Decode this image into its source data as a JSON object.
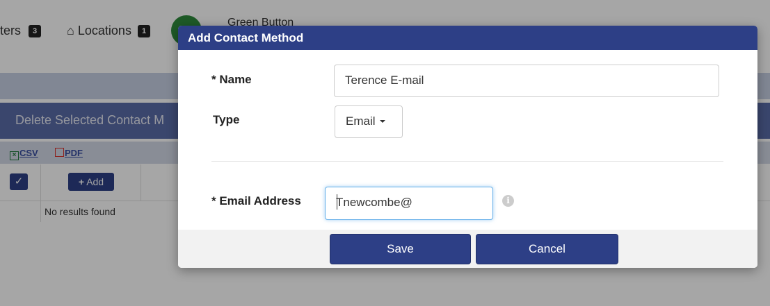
{
  "background": {
    "nav": {
      "meters_label": "ters",
      "meters_count": "3",
      "locations_label": "Locations",
      "locations_count": "1",
      "green_button_label": "Green Button"
    },
    "delete_selected_label": "Delete Selected Contact M",
    "export": {
      "csv_label": "CSV",
      "pdf_label": "PDF"
    },
    "table": {
      "add_label": "Add",
      "empty_text": "No results found"
    }
  },
  "modal": {
    "title": "Add Contact Method",
    "name_label": "* Name",
    "name_value": "Terence E-mail",
    "type_label": "Type",
    "type_value": "Email",
    "email_label": "* Email Address",
    "email_value": "Tnewcombe@",
    "info_icon_glyph": "i",
    "save_label": "Save",
    "cancel_label": "Cancel"
  },
  "colors": {
    "accent": "#2d3f86",
    "overlay": "rgba(0,0,0,0.35)",
    "focus": "#66afe9"
  }
}
